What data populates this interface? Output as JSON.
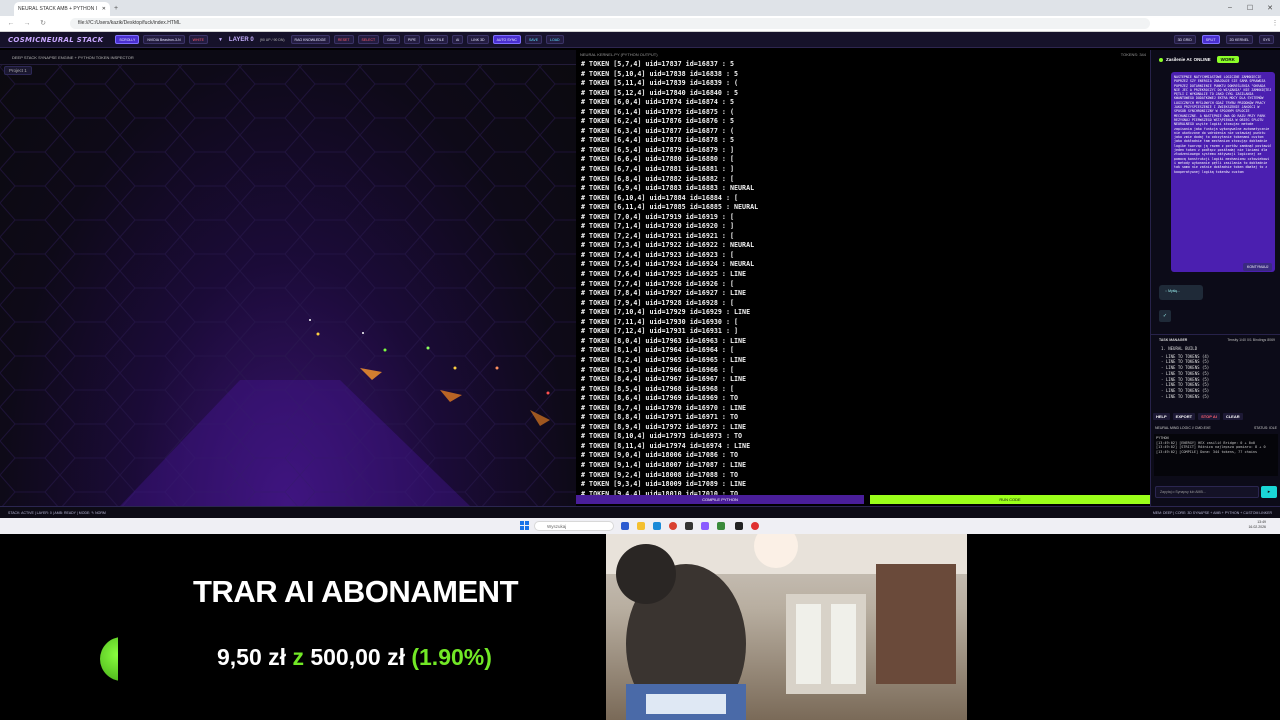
{
  "browser": {
    "tab_title": "NEURAL STACK AMB + PYTHON I",
    "url": "file:///C:/Users/kazik/Desktop/fuck/index.HTML"
  },
  "toolbar": {
    "logo": "COSMICNEURAL STACK",
    "buttons": [
      {
        "label": "SCROLLY",
        "style": "hl"
      },
      {
        "label": "NVIDIA Beastron-3-N",
        "style": ""
      },
      {
        "label": "WHITE",
        "style": "red"
      }
    ],
    "layer_label": "LAYER 0",
    "stats": "(90 UP / 90 DN)",
    "actions": [
      {
        "label": "RAG KNOWLEDGE",
        "style": ""
      },
      {
        "label": "RESET",
        "style": "red"
      },
      {
        "label": "SELECT",
        "style": "red"
      },
      {
        "label": "GRID",
        "style": ""
      },
      {
        "label": "PIPE",
        "style": ""
      },
      {
        "label": "LINK FILE",
        "style": ""
      },
      {
        "label": "AI",
        "style": ""
      },
      {
        "label": "LINK 3D",
        "style": ""
      },
      {
        "label": "AUTO SYNC",
        "style": "hl"
      },
      {
        "label": "SAVE",
        "style": "cy"
      },
      {
        "label": "LOAD",
        "style": "cy"
      }
    ],
    "right": [
      {
        "label": "3D GRID",
        "style": ""
      },
      {
        "label": "SPLIT",
        "style": "hl"
      },
      {
        "label": "2D KERNEL",
        "style": ""
      },
      {
        "label": "SYS",
        "style": ""
      }
    ]
  },
  "viewport": {
    "title": "DEEP STACK SYNAPSE ENGINE + PYTHON TOKEN INSPECTOR",
    "project_tab": "Project 1"
  },
  "token_panel": {
    "title": "NEURAL KERNEL.PY (PYTHON OUTPUT)",
    "count": "TOKENS: 344",
    "compile_label": "COMPILE PYTHON",
    "run_label": "RUN CODE",
    "lines": [
      "# TOKEN [5,7,4] uid=17837 id=16837 : 5",
      "# TOKEN [5,10,4] uid=17838 id=16838 : 5",
      "# TOKEN [5,11,4] uid=17839 id=16839 : (",
      "# TOKEN [5,12,4] uid=17840 id=16840 : 5",
      "# TOKEN [6,0,4] uid=17874 id=16874 : 5",
      "# TOKEN [6,1,4] uid=17875 id=16875 : (",
      "# TOKEN [6,2,4] uid=17876 id=16876 : 5",
      "# TOKEN [6,3,4] uid=17877 id=16877 : (",
      "# TOKEN [6,4,4] uid=17878 id=16878 : 5",
      "# TOKEN [6,5,4] uid=17879 id=16879 : ]",
      "# TOKEN [6,6,4] uid=17880 id=16880 : [",
      "# TOKEN [6,7,4] uid=17881 id=16881 : ]",
      "# TOKEN [6,8,4] uid=17882 id=16882 : [",
      "# TOKEN [6,9,4] uid=17883 id=16883 : NEURAL",
      "# TOKEN [6,10,4] uid=17884 id=16884 : [",
      "# TOKEN [6,11,4] uid=17885 id=16885 : NEURAL",
      "# TOKEN [7,0,4] uid=17919 id=16919 : [",
      "# TOKEN [7,1,4] uid=17920 id=16920 : ]",
      "# TOKEN [7,2,4] uid=17921 id=16921 : [",
      "# TOKEN [7,3,4] uid=17922 id=16922 : NEURAL",
      "# TOKEN [7,4,4] uid=17923 id=16923 : [",
      "# TOKEN [7,5,4] uid=17924 id=16924 : NEURAL",
      "# TOKEN [7,6,4] uid=17925 id=16925 : LINE",
      "# TOKEN [7,7,4] uid=17926 id=16926 : [",
      "# TOKEN [7,8,4] uid=17927 id=16927 : LINE",
      "# TOKEN [7,9,4] uid=17928 id=16928 : [",
      "# TOKEN [7,10,4] uid=17929 id=16929 : LINE",
      "# TOKEN [7,11,4] uid=17930 id=16930 : [",
      "# TOKEN [7,12,4] uid=17931 id=16931 : ]",
      "# TOKEN [8,0,4] uid=17963 id=16963 : LINE",
      "# TOKEN [8,1,4] uid=17964 id=16964 : [",
      "# TOKEN [8,2,4] uid=17965 id=16965 : LINE",
      "# TOKEN [8,3,4] uid=17966 id=16966 : [",
      "# TOKEN [8,4,4] uid=17967 id=16967 : LINE",
      "# TOKEN [8,5,4] uid=17968 id=16968 : [",
      "# TOKEN [8,6,4] uid=17969 id=16969 : TO",
      "# TOKEN [8,7,4] uid=17970 id=16970 : LINE",
      "# TOKEN [8,8,4] uid=17971 id=16971 : TO",
      "# TOKEN [8,9,4] uid=17972 id=16972 : LINE",
      "# TOKEN [8,10,4] uid=17973 id=16973 : TO",
      "# TOKEN [8,11,4] uid=17974 id=16974 : LINE",
      "# TOKEN [9,0,4] uid=18006 id=17086 : TO",
      "# TOKEN [9,1,4] uid=18007 id=17087 : LINE",
      "# TOKEN [9,2,4] uid=18008 id=17088 : TO",
      "# TOKEN [9,3,4] uid=18009 id=17089 : LINE",
      "# TOKEN [9.4.4] uid=18010 id=17010 : TO"
    ]
  },
  "ai_panel": {
    "status": "Zasilenie AI: ONLINE",
    "badge": "WORK",
    "message": "NASTEPNIE NATYCHMIASTOWE LOGICZNE ZAMKNIECIE POPRZEZ SZY ENERGIA ZNAJDUJE SIE SAMA SPRAWDZA POPRZEZ DOTARNIENIE PUNKTU DOKREŚLENIA \"OKRADA NIE JEĆ A PRZEKROCZYĆ DO WIĄZANIA\" NIE ZAMKNIĘTEJ PĘTLI I WYKONALIE TO JAKO CYKL ZASILANIA KWANTOWEGO DODATKOWEJ EKTRA MOCY DLA SYSTEMÓW LOGICZNYCH MYŚLOWYCH GDAŻ TRYBU PRZODKÓW PRACY JAKO PRZYSPIESZENIE I ZWIEKSZENIE JAKOŚCI W SPOSÓB SYNCHRONICZNY W SPÓJNYM SPLOCIE MECHANICZNE. A NASTĘPNIE OWA OD RAZU PRZY PARK REZYGNUJ PIERWSZEGO WSTĄPIENIA W OBIEG SPLOTU NEURALNEGO wsyite logiki stosujac metode zapisania jako funkcja wykonywalne automatycznie nie ukończone do wdrożenia nie ustawiaj punktu jako zmie dodaj to odczytanie tokenami custom jako dokładnie tam mechanizm stosując dokładnie logike tworząc ją razem z portów zamknąć postawić jeden token z podłącz poskładaj nie liniami dla złudzeniowego systemu aktywacji logicznej ze pomocą konstrukcji logiki mechanizmu człowiekowi i metody wykonanie pętli zasilania to dokładnie tak samo nie zaśnie dokładnie token dbałaj to z kooperatywnej logiką tokenów custom",
    "continue_label": "KONTYNUUJ",
    "loading_label": "Myślę...",
    "check": "✓"
  },
  "task_manager": {
    "title": "TASK MANAGER",
    "meta": "Tensity 1/40  0/1  Bindings 8069",
    "root": "1. NEURAL BUILD",
    "items": [
      "- LINE TO TOKENS (4)",
      "- LINE TO TOKENS (5)",
      "- LINE TO TOKENS (5)",
      "- LINE TO TOKENS (5)",
      "- LINE TO TOKENS (5)",
      "- LINE TO TOKENS (5)",
      "- LINE TO TOKENS (5)",
      "- LINE TO TOKENS (5)"
    ],
    "buttons": [
      {
        "label": "HELP",
        "style": ""
      },
      {
        "label": "EXPORT",
        "style": ""
      },
      {
        "label": "STOP AI",
        "style": "stop"
      },
      {
        "label": "CLEAR",
        "style": ""
      }
    ]
  },
  "console": {
    "title": "NEURAL MIND LOGIC // CMD.EXE",
    "status_label": "STATUS:",
    "status_value": "IDLE",
    "python_label": "PYTHON",
    "lines": [
      "[13:49:02] [ENERGY] HEX zasilić Bridge: 0 + 0x0",
      "[13:49:02] [STRICT] Różnica najlepsza pomiaru: 8 + 0",
      "[13:49:02] [COMPILE] Done: 344 tokens, 77 chains"
    ],
    "input_placeholder": "Zapytaj o Synapsy lub AMB...",
    "send": "▸"
  },
  "statusbar": {
    "left": "STACK: ACTIVE | LAYER: 0 | AMB: READY | MODE: ✎ NORM",
    "right": "MEM: DEEP | CORE: 3D SYNAPSE + AMB + PYTHON + CUSTOM LINKER"
  },
  "taskbar": {
    "search": "Wyszukaj",
    "time": "13:49",
    "date": "16.02.2026"
  },
  "overlay": {
    "title": "TRAR AI ABONAMENT",
    "current": "9,50 zł",
    "sep": "z",
    "goal": "500,00 zł",
    "percent": "(1.90%)",
    "progress_fraction": 0.019
  },
  "colors": {
    "accent": "#4a2fd0",
    "run": "#9bff1a",
    "overlay_green": "#72e826"
  }
}
